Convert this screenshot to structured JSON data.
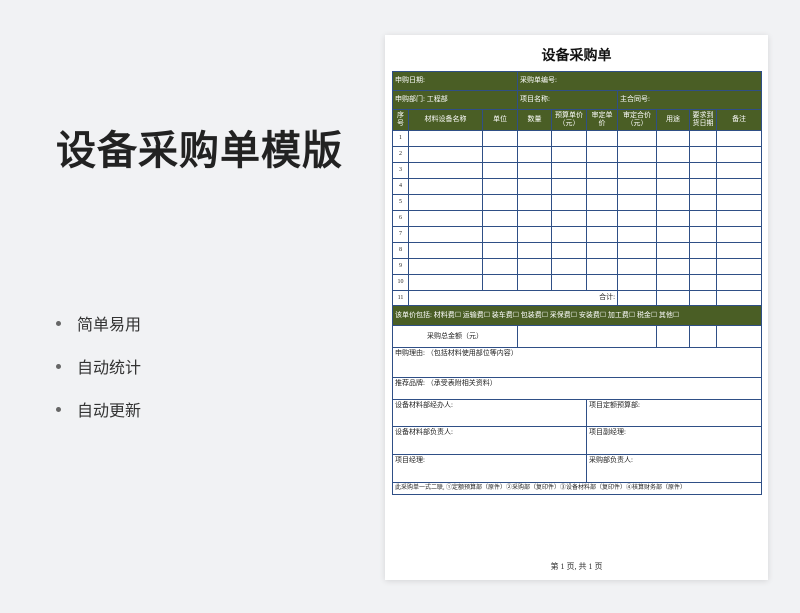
{
  "hero": {
    "title": "设备采购单模版",
    "features": [
      "简单易用",
      "自动统计",
      "自动更新"
    ]
  },
  "form": {
    "title": "设备采购单",
    "fields": {
      "apply_date": "申购日期:",
      "order_no": "采购单编号:",
      "dept": "申购部门: 工程部",
      "project": "项目名称:",
      "contract": "主合同号:"
    },
    "columns": [
      "序号",
      "材料设备名称",
      "单位",
      "数量",
      "预算单价（元）",
      "审定单价",
      "审定合价（元）",
      "用途",
      "要求到货日期",
      "备注"
    ],
    "rows": [
      "1",
      "2",
      "3",
      "4",
      "5",
      "6",
      "7",
      "8",
      "9",
      "10",
      "11"
    ],
    "total_label": "合计:",
    "price_includes": "该单价包括: 材料费☐ 运输费☐ 装车费☐ 包装费☐ 采保费☐ 安装费☐ 加工费☐ 税金☐ 其他☐",
    "total_amount_label": "采购总金额（元）",
    "reason": "申购理由: （包括材料使用部位等内容）",
    "brand": "推荐品牌: （承受表附相关资料）",
    "signatures": {
      "material_handler": "设备材料部经办人:",
      "budget_dept": "项目定额预算部:",
      "material_head": "设备材料部负责人:",
      "deputy_manager": "项目副经理:",
      "project_manager": "项目经理:",
      "purchase_head": "采购部负责人:"
    },
    "note": "此采购单一式二联, ①定额预算部（原件）②采购部（复印件）③设备材料部（复印件）④核算财务部（原件）",
    "page_footer": "第 1 页, 共 1 页"
  },
  "colors": {
    "header_green": "#4a5e25",
    "border_blue": "#2f4f86"
  }
}
